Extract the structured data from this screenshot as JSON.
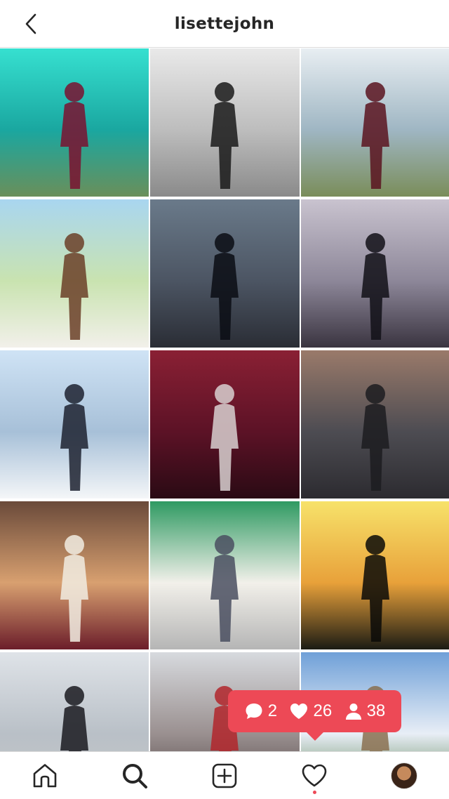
{
  "header": {
    "title": "lisettejohn",
    "back_icon": "chevron-left-icon"
  },
  "grid": {
    "tiles": [
      {
        "name": "post-1",
        "colors": [
          "#36e0d0",
          "#1aa7a0",
          "#6a8f5a"
        ],
        "subject": "#7a1230"
      },
      {
        "name": "post-2",
        "colors": [
          "#e9e9e9",
          "#bdbdbd",
          "#8a8a8a"
        ],
        "subject": "#1a1a1a"
      },
      {
        "name": "post-3",
        "colors": [
          "#e8eef2",
          "#9fb6c3",
          "#7a8d5a"
        ],
        "subject": "#5a1420"
      },
      {
        "name": "post-4",
        "colors": [
          "#a9d6f0",
          "#c9e3b0",
          "#f2f0ea"
        ],
        "subject": "#6b4028"
      },
      {
        "name": "post-5",
        "colors": [
          "#6a7a8a",
          "#4c5563",
          "#2a2d35"
        ],
        "subject": "#0b0d14"
      },
      {
        "name": "post-6",
        "colors": [
          "#c9c3cf",
          "#8d8799",
          "#3a3440"
        ],
        "subject": "#121018"
      },
      {
        "name": "post-7",
        "colors": [
          "#cfe3f5",
          "#a7c0d8",
          "#f4f6f8"
        ],
        "subject": "#1d2230"
      },
      {
        "name": "post-8",
        "colors": [
          "#8a2034",
          "#5c1226",
          "#2a0a14"
        ],
        "subject": "#d8d0d0"
      },
      {
        "name": "post-9",
        "colors": [
          "#9a7a6a",
          "#4d4c52",
          "#2c2b30"
        ],
        "subject": "#1c1c20"
      },
      {
        "name": "post-10",
        "colors": [
          "#6a4a3a",
          "#d8a070",
          "#6b1d2a"
        ],
        "subject": "#f1ece2"
      },
      {
        "name": "post-11",
        "colors": [
          "#2f9a62",
          "#f2f0ea",
          "#b5b5b5"
        ],
        "subject": "#4a4f60"
      },
      {
        "name": "post-12",
        "colors": [
          "#f7e26a",
          "#e8a13a",
          "#1b1b14"
        ],
        "subject": "#0b0b08"
      },
      {
        "name": "post-13",
        "colors": [
          "#dfe3e8",
          "#b9c0c7",
          "#c7c7c7"
        ],
        "subject": "#1a1a20"
      },
      {
        "name": "post-14",
        "colors": [
          "#d7dade",
          "#9a9090",
          "#4a3e3e"
        ],
        "subject": "#b2262c"
      },
      {
        "name": "post-15",
        "colors": [
          "#6fa0d8",
          "#e8eef6",
          "#3e6a30"
        ],
        "subject": "#8a7050"
      }
    ]
  },
  "activity": {
    "comments_count": "2",
    "likes_count": "26",
    "followers_count": "38",
    "comment_icon": "comment-bubble-icon",
    "like_icon": "heart-icon",
    "follower_icon": "person-icon"
  },
  "nav": {
    "items": [
      {
        "name": "nav-home",
        "icon": "home-icon"
      },
      {
        "name": "nav-search",
        "icon": "search-icon"
      },
      {
        "name": "nav-new-post",
        "icon": "plus-square-icon"
      },
      {
        "name": "nav-activity",
        "icon": "heart-outline-icon"
      },
      {
        "name": "nav-profile",
        "icon": "avatar"
      }
    ]
  },
  "colors": {
    "accent": "#ed4956",
    "text": "#262626",
    "border": "#dbdbdb"
  }
}
